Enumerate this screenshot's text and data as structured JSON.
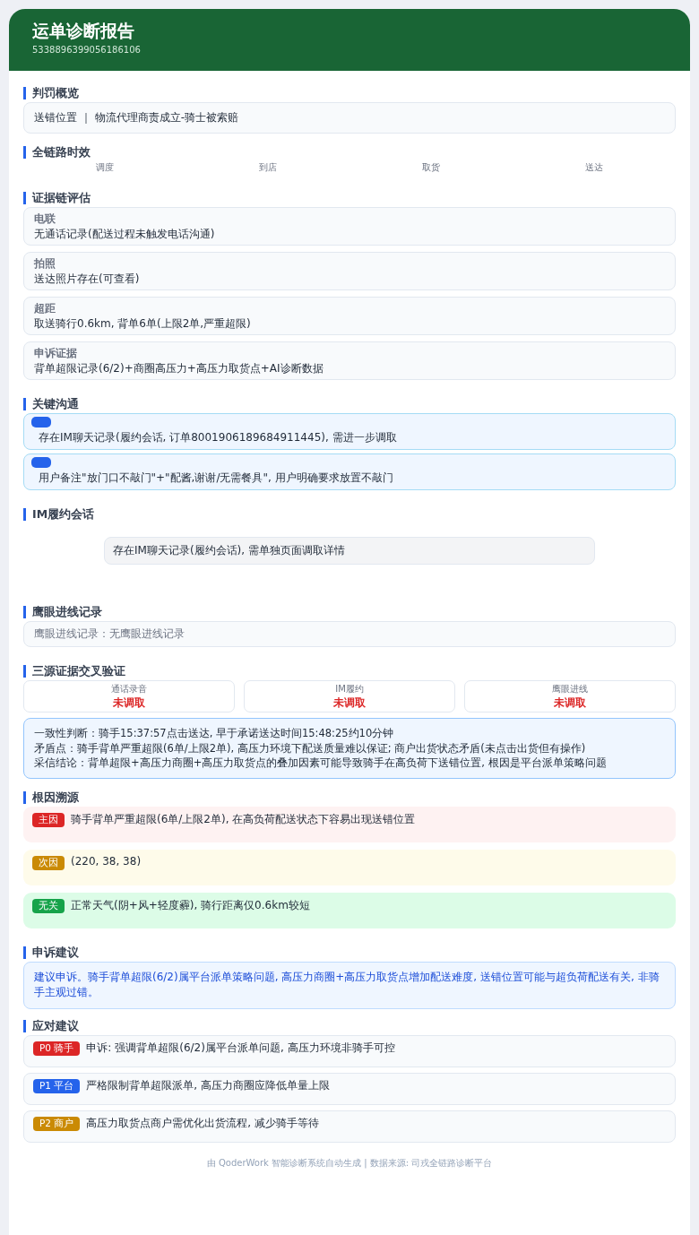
{
  "header": {
    "title": "运单诊断报告",
    "order_id": "5338896399056186106"
  },
  "penalty_overview": {
    "title": "判罚概览",
    "summary": "送错位置 ｜ 物流代理商责成立-骑士被索赔"
  },
  "timeline": {
    "title": "全链路时效",
    "stages": [
      "调度",
      "到店",
      "取货",
      "送达"
    ]
  },
  "evidence": {
    "title": "证据链评估",
    "items": [
      {
        "label": "电联",
        "value": "无通话记录(配送过程未触发电话沟通)"
      },
      {
        "label": "拍照",
        "value": "送达照片存在(可查看)"
      },
      {
        "label": "超距",
        "value": "取送骑行0.6km, 背单6单(上限2单,严重超限)"
      },
      {
        "label": "申诉证据",
        "value": "背单超限记录(6/2)+商圈高压力+高压力取货点+AI诊断数据"
      }
    ]
  },
  "key_communication": {
    "title": "关键沟通",
    "items": [
      "存在IM聊天记录(履约会话, 订单8001906189684911445), 需进一步调取",
      "用户备注\"放门口不敲门\"+\"配酱,谢谢/无需餐具\", 用户明确要求放置不敲门"
    ]
  },
  "im_session": {
    "title": "IM履约会话",
    "note": "存在IM聊天记录(履约会话), 需单独页面调取详情"
  },
  "eagle_eye": {
    "title": "鹰眼进线记录",
    "note": "鹰眼进线记录：无鹰眼进线记录"
  },
  "cross_check": {
    "title": "三源证据交叉验证",
    "sources": [
      {
        "label": "通话录音",
        "status": "未调取"
      },
      {
        "label": "IM履约",
        "status": "未调取"
      },
      {
        "label": "鹰眼进线",
        "status": "未调取"
      }
    ],
    "lines": [
      "一致性判断：骑手15:37:57点击送达, 早于承诺送达时间15:48:25约10分钟",
      "矛盾点：骑手背单严重超限(6单/上限2单), 高压力环境下配送质量难以保证; 商户出货状态矛盾(未点击出货但有操作)",
      "采信结论：背单超限+高压力商圈+高压力取货点的叠加因素可能导致骑手在高负荷下送错位置, 根因是平台派单策略问题"
    ]
  },
  "root_cause": {
    "title": "根因溯源",
    "items": [
      {
        "kind": "primary",
        "tag": "主因",
        "text": "骑手背单严重超限(6单/上限2单), 在高负荷配送状态下容易出现送错位置"
      },
      {
        "kind": "secondary",
        "tag": "次因",
        "text": "(220, 38, 38)"
      },
      {
        "kind": "unrelated",
        "tag": "无关",
        "text": "正常天气(阴+风+轻度霾), 骑行距离仅0.6km较短"
      }
    ]
  },
  "appeal": {
    "title": "申诉建议",
    "text": "建议申诉。骑手背单超限(6/2)属平台派单策略问题, 高压力商圈+高压力取货点增加配送难度, 送错位置可能与超负荷配送有关, 非骑手主观过错。"
  },
  "actions": {
    "title": "应对建议",
    "items": [
      {
        "tag": "P0 骑手",
        "color": "#dc2626",
        "text": "申诉: 强调背单超限(6/2)属平台派单问题, 高压力环境非骑手可控"
      },
      {
        "tag": "P1 平台",
        "color": "#2563eb",
        "text": "严格限制背单超限派单, 高压力商圈应降低单量上限"
      },
      {
        "tag": "P2 商户",
        "color": "#ca8a04",
        "text": "高压力取货点商户需优化出货流程, 减少骑手等待"
      }
    ]
  },
  "footer": "由 QoderWork 智能诊断系统自动生成 | 数据来源: 司戎全链路诊断平台"
}
